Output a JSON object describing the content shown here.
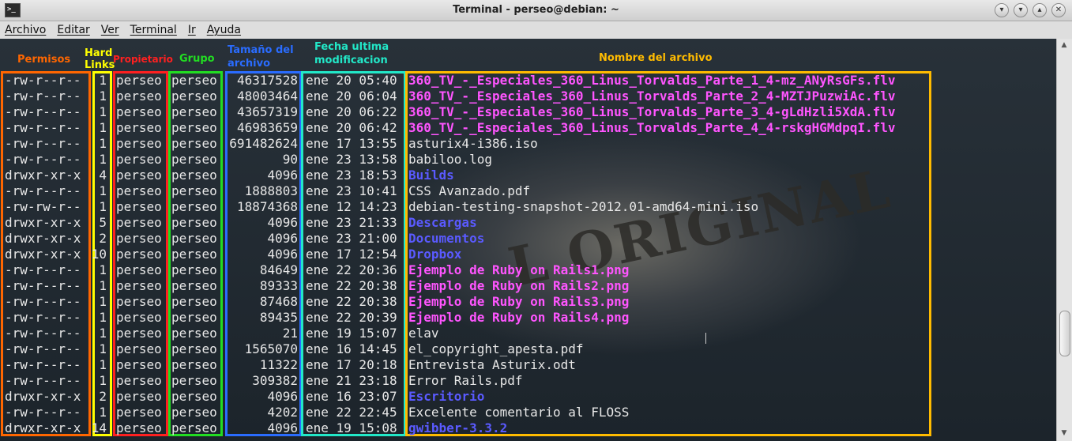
{
  "window": {
    "title": "Terminal - perseo@debian: ~",
    "icon_glyph": ">_",
    "buttons": [
      "▾",
      "▾",
      "▴",
      "✕"
    ]
  },
  "menu": [
    "Archivo",
    "Editar",
    "Ver",
    "Terminal",
    "Ir",
    "Ayuda"
  ],
  "annotations": {
    "permisos": {
      "label": "Permisos",
      "color": "#ff6600"
    },
    "links": {
      "label1": "Hard",
      "label2": "Links",
      "color": "#ffff00"
    },
    "propietario": {
      "label": "Propietario",
      "color": "#ff2020"
    },
    "grupo": {
      "label": "Grupo",
      "color": "#22dd22"
    },
    "tamano": {
      "label1": "Tamaño del",
      "label2": "archivo",
      "color": "#2a6cff"
    },
    "fecha": {
      "label1": "Fecha ultima",
      "label2": "modificacion",
      "color": "#22e8c8"
    },
    "nombre": {
      "label": "Nombre del archivo",
      "color": "#ffbb00"
    }
  },
  "watermark": "L ORIGINAL",
  "files": [
    {
      "perm": "-rw-r--r--",
      "links": "1",
      "owner": "perseo",
      "group": "perseo",
      "size": "46317528",
      "date": "ene 20 05:40",
      "name": "360_TV_-_Especiales_360_Linus_Torvalds_Parte_1_4-mz_ANyRsGFs.flv",
      "kind": "flv"
    },
    {
      "perm": "-rw-r--r--",
      "links": "1",
      "owner": "perseo",
      "group": "perseo",
      "size": "48003464",
      "date": "ene 20 06:04",
      "name": "360_TV_-_Especiales_360_Linus_Torvalds_Parte_2_4-MZTJPuzwiAc.flv",
      "kind": "flv"
    },
    {
      "perm": "-rw-r--r--",
      "links": "1",
      "owner": "perseo",
      "group": "perseo",
      "size": "43657319",
      "date": "ene 20 06:22",
      "name": "360_TV_-_Especiales_360_Linus_Torvalds_Parte_3_4-gLdHzli5XdA.flv",
      "kind": "flv"
    },
    {
      "perm": "-rw-r--r--",
      "links": "1",
      "owner": "perseo",
      "group": "perseo",
      "size": "46983659",
      "date": "ene 20 06:42",
      "name": "360_TV_-_Especiales_360_Linus_Torvalds_Parte_4_4-rskgHGMdpqI.flv",
      "kind": "flv"
    },
    {
      "perm": "-rw-r--r--",
      "links": "1",
      "owner": "perseo",
      "group": "perseo",
      "size": "691482624",
      "date": "ene 17 13:55",
      "name": "asturix4-i386.iso",
      "kind": "file"
    },
    {
      "perm": "-rw-r--r--",
      "links": "1",
      "owner": "perseo",
      "group": "perseo",
      "size": "90",
      "date": "ene 23 13:58",
      "name": "babiloo.log",
      "kind": "file"
    },
    {
      "perm": "drwxr-xr-x",
      "links": "4",
      "owner": "perseo",
      "group": "perseo",
      "size": "4096",
      "date": "ene 23 18:53",
      "name": "Builds",
      "kind": "dir"
    },
    {
      "perm": "-rw-r--r--",
      "links": "1",
      "owner": "perseo",
      "group": "perseo",
      "size": "1888803",
      "date": "ene 23 10:41",
      "name": "CSS Avanzado.pdf",
      "kind": "file"
    },
    {
      "perm": "-rw-rw-r--",
      "links": "1",
      "owner": "perseo",
      "group": "perseo",
      "size": "18874368",
      "date": "ene 12 14:23",
      "name": "debian-testing-snapshot-2012.01-amd64-mini.iso",
      "kind": "file"
    },
    {
      "perm": "drwxr-xr-x",
      "links": "5",
      "owner": "perseo",
      "group": "perseo",
      "size": "4096",
      "date": "ene 23 21:33",
      "name": "Descargas",
      "kind": "dir"
    },
    {
      "perm": "drwxr-xr-x",
      "links": "2",
      "owner": "perseo",
      "group": "perseo",
      "size": "4096",
      "date": "ene 23 21:00",
      "name": "Documentos",
      "kind": "dir"
    },
    {
      "perm": "drwxr-xr-x",
      "links": "10",
      "owner": "perseo",
      "group": "perseo",
      "size": "4096",
      "date": "ene 17 12:54",
      "name": "Dropbox",
      "kind": "dir"
    },
    {
      "perm": "-rw-r--r--",
      "links": "1",
      "owner": "perseo",
      "group": "perseo",
      "size": "84649",
      "date": "ene 22 20:36",
      "name": "Ejemplo de Ruby on Rails1.png",
      "kind": "png"
    },
    {
      "perm": "-rw-r--r--",
      "links": "1",
      "owner": "perseo",
      "group": "perseo",
      "size": "89333",
      "date": "ene 22 20:38",
      "name": "Ejemplo de Ruby on Rails2.png",
      "kind": "png"
    },
    {
      "perm": "-rw-r--r--",
      "links": "1",
      "owner": "perseo",
      "group": "perseo",
      "size": "87468",
      "date": "ene 22 20:38",
      "name": "Ejemplo de Ruby on Rails3.png",
      "kind": "png"
    },
    {
      "perm": "-rw-r--r--",
      "links": "1",
      "owner": "perseo",
      "group": "perseo",
      "size": "89435",
      "date": "ene 22 20:39",
      "name": "Ejemplo de Ruby on Rails4.png",
      "kind": "png"
    },
    {
      "perm": "-rw-r--r--",
      "links": "1",
      "owner": "perseo",
      "group": "perseo",
      "size": "21",
      "date": "ene 19 15:07",
      "name": "elav",
      "kind": "file"
    },
    {
      "perm": "-rw-r--r--",
      "links": "1",
      "owner": "perseo",
      "group": "perseo",
      "size": "1565070",
      "date": "ene 16 14:45",
      "name": "el_copyright_apesta.pdf",
      "kind": "file"
    },
    {
      "perm": "-rw-r--r--",
      "links": "1",
      "owner": "perseo",
      "group": "perseo",
      "size": "11322",
      "date": "ene 17 20:18",
      "name": "Entrevista Asturix.odt",
      "kind": "file"
    },
    {
      "perm": "-rw-r--r--",
      "links": "1",
      "owner": "perseo",
      "group": "perseo",
      "size": "309382",
      "date": "ene 21 23:18",
      "name": "Error Rails.pdf",
      "kind": "file"
    },
    {
      "perm": "drwxr-xr-x",
      "links": "2",
      "owner": "perseo",
      "group": "perseo",
      "size": "4096",
      "date": "ene 16 23:07",
      "name": "Escritorio",
      "kind": "dir"
    },
    {
      "perm": "-rw-r--r--",
      "links": "1",
      "owner": "perseo",
      "group": "perseo",
      "size": "4202",
      "date": "ene 22 22:45",
      "name": "Excelente comentario al FLOSS",
      "kind": "file"
    },
    {
      "perm": "drwxr-xr-x",
      "links": "14",
      "owner": "perseo",
      "group": "perseo",
      "size": "4096",
      "date": "ene 19 15:08",
      "name": "gwibber-3.3.2",
      "kind": "dir"
    }
  ]
}
